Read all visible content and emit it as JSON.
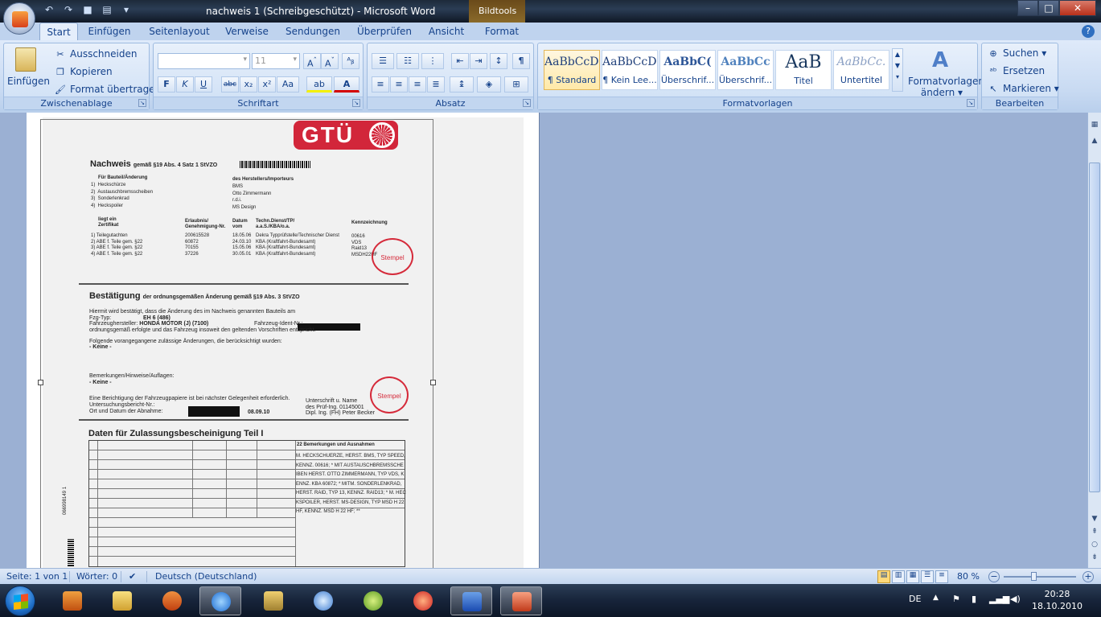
{
  "window": {
    "title": "nachweis 1 (Schreibgeschützt) - Microsoft Word",
    "context_tab": "Bildtools"
  },
  "tabs": [
    "Start",
    "Einfügen",
    "Seitenlayout",
    "Verweise",
    "Sendungen",
    "Überprüfen",
    "Ansicht",
    "Format"
  ],
  "ribbon": {
    "clipboard": {
      "label": "Zwischenablage",
      "paste": "Einfügen",
      "cut": "Ausschneiden",
      "copy": "Kopieren",
      "format_painter": "Format übertragen"
    },
    "font": {
      "label": "Schriftart",
      "size": "11",
      "bold": "F",
      "italic": "K",
      "underline": "U",
      "strike": "abc",
      "sub": "x₂",
      "sup": "x²",
      "case": "Aa"
    },
    "paragraph": {
      "label": "Absatz"
    },
    "styles": {
      "label": "Formatvorlagen",
      "items": [
        {
          "sample": "AaBbCcDc",
          "name": "¶ Standard"
        },
        {
          "sample": "AaBbCcDc",
          "name": "¶ Kein Lee..."
        },
        {
          "sample": "AaBbC(",
          "name": "Überschrif..."
        },
        {
          "sample": "AaBbCc",
          "name": "Überschrif..."
        },
        {
          "sample": "AaB",
          "name": "Titel"
        },
        {
          "sample": "AaBbCc.",
          "name": "Untertitel"
        }
      ],
      "change_styles": "Formatvorlagen",
      "change_styles_2": "ändern"
    },
    "editing": {
      "label": "Bearbeiten",
      "find": "Suchen",
      "replace": "Ersetzen",
      "select": "Markieren"
    }
  },
  "document": {
    "logo": "GTÜ",
    "heading": "Nachweis",
    "heading_sub": "gemäß §19 Abs. 4 Satz 1 StVZO",
    "parts_header": "Für Bauteil/Änderung",
    "maker_header": "des Herstellers/Importeurs",
    "parts": [
      "1)  Heckschürze",
      "2)  Austauschbremsscheiben",
      "3)  Sonderlenkrad",
      "4)  Heckspoiler"
    ],
    "makers": [
      "BMS",
      "Otto Zimmermann",
      "r.d.i.",
      "MS Design"
    ],
    "col_headers": [
      "liegt ein\nZertifikat",
      "Erlaubnis/\nGenehmigung-Nr.",
      "Datum\nvom",
      "Techn.Dienst/TP/\na.a.S./KBA/o.a.",
      "Kennzeichnung"
    ],
    "cert_rows": [
      [
        "1)  Teilegutachten",
        "200615528",
        "18.05.06",
        "Dekra Typprüfstelle/Technischer Dienst",
        "00616"
      ],
      [
        "2)  ABE f. Teile gem. §22",
        "60872",
        "24.03.10",
        "KBA (Kraftfahrt-Bundesamt)",
        "VDS"
      ],
      [
        "3)  ABE f. Teile gem. §22",
        "70155",
        "15.05.06",
        "KBA (Kraftfahrt-Bundesamt)",
        "Raid13"
      ],
      [
        "4)  ABE f. Teile gem. §22",
        "37226",
        "30.05.01",
        "KBA (Kraftfahrt-Bundesamt)",
        "MSDH22HF"
      ]
    ],
    "confirm_heading": "Bestätigung",
    "confirm_sub": "der ordnungsgemäßen Änderung gemäß §19 Abs. 3 StVZO",
    "confirm_text": "Hiermit wird bestätigt, dass die Änderung des im Nachweis genannten Bauteils am",
    "vehicle_type_label": "Fzg-Typ:",
    "vehicle_type": "EH 6 (486)",
    "maker_label": "Fahrzeughersteller:",
    "maker": "HONDA MOTOR (J) (7100)",
    "ident_label": "Fahrzeug-Ident-Nr.:",
    "proper_text": "ordnungsgemäß erfolgte und das Fahrzeug insoweit den geltenden Vorschriften entspricht.",
    "prior_text": "Folgende vorangegangene zulässige Änderungen, die berücksichtigt wurden:",
    "none1": "- Keine -",
    "remarks_label": "Bemerkungen/Hinweise/Auflagen:",
    "none2": "- Keine -",
    "correction_text": "Eine Berichtigung der Fahrzeugpapiere ist bei nächster Gelegenheit erforderlich.",
    "report_label": "Untersuchungsbericht-Nr.:",
    "place_label": "Ort und Datum der Abnahme:",
    "date": "08.09.10",
    "sign_label": "Unterschrift u. Name",
    "sign_2": "des Prüf-Ing. 01145001",
    "sign_3": "Dipl. Ing. (FH) Peter Becker",
    "stamp": "Stempel",
    "data_heading": "Daten für Zulassungsbescheinigung Teil I",
    "remarks_header": "22  Bemerkungen und Ausnahmen",
    "remarks_lines": [
      "M. HECKSCHUERZE, HERST. BMS, TYP SPEED,",
      "KENNZ. 00616; * MIT AUSTAUSCHBREMSSCHE",
      "IBEN HERST. OTTO ZIMMERMANN, TYP VDS, K",
      "ENNZ. KBA 60872; * MITM. SONDERLENKRAD,",
      "HERST. RAID, TYP 13, KENNZ. RAID13; * M. HEC",
      "KSPOILER, HERST. MS-DESIGN, TYP MSD H 22",
      "HF, KENNZ. MSD H 22 HF; **"
    ],
    "side_number": "066998149 1"
  },
  "status": {
    "page": "Seite: 1 von 1",
    "words": "Wörter: 0",
    "language": "Deutsch (Deutschland)",
    "zoom": "80 %"
  },
  "tray": {
    "lang": "DE",
    "time": "20:28",
    "date": "18.10.2010"
  }
}
